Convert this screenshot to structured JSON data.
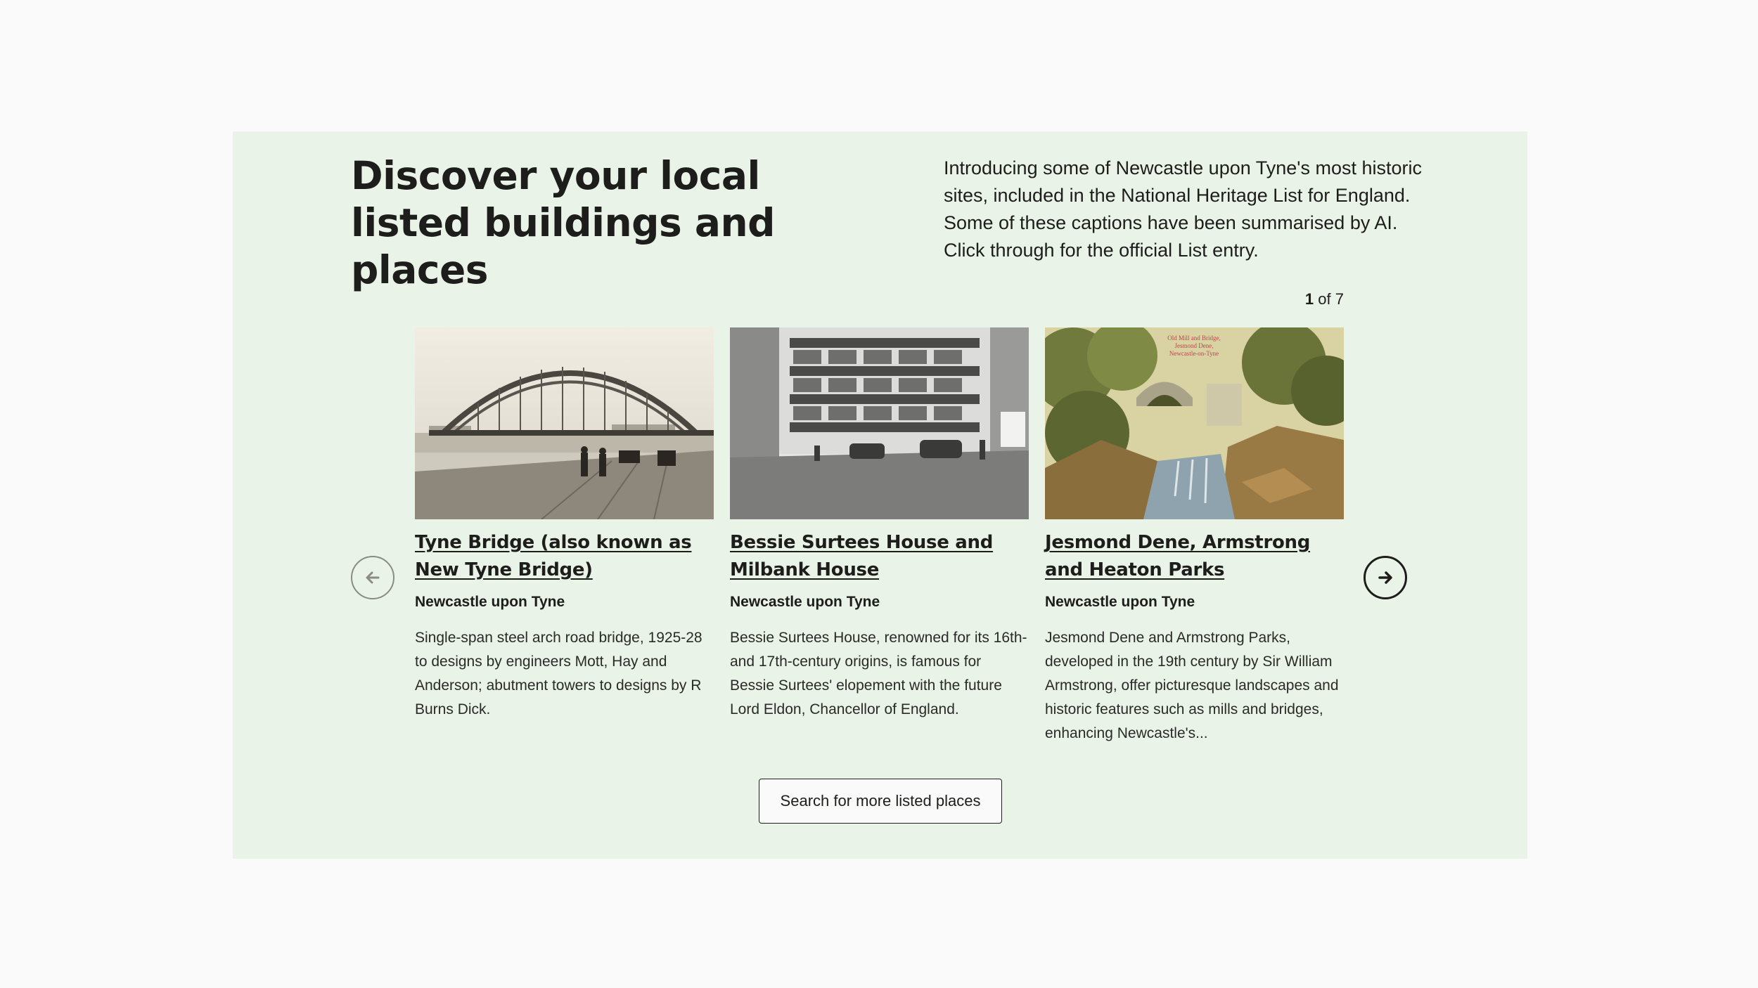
{
  "section": {
    "title": "Discover your local listed buildings and places",
    "intro": "Introducing some of Newcastle upon Tyne's most historic sites, included in the National Heritage List for England. Some of these captions have been summarised by AI. Click through for the official List entry."
  },
  "pager": {
    "current": "1",
    "separator": "of",
    "total": "7"
  },
  "nav": {
    "prev_icon": "arrow-left-icon",
    "next_icon": "arrow-right-icon"
  },
  "cards": [
    {
      "title": "Tyne Bridge (also known as New Tyne Bridge)",
      "location": "Newcastle upon Tyne",
      "description": "Single-span steel arch road bridge, 1925-28 to designs by engineers Mott, Hay and Anderson; abutment towers to designs by R Burns Dick."
    },
    {
      "title": "Bessie Surtees House and Milbank House",
      "location": "Newcastle upon Tyne",
      "description": "Bessie Surtees House, renowned for its 16th- and 17th-century origins, is famous for Bessie Surtees' elopement with the future Lord Eldon, Chancellor of England."
    },
    {
      "title": "Jesmond Dene, Armstrong and Heaton Parks",
      "location": "Newcastle upon Tyne",
      "description": "Jesmond Dene and Armstrong Parks, developed in the 19th century by Sir William Armstrong, offer picturesque landscapes and historic features such as mills and bridges, enhancing Newcastle's..."
    }
  ],
  "search_button": {
    "label": "Search for more listed places"
  },
  "colors": {
    "panel_bg": "#eaf3e8",
    "page_bg": "#fafafa",
    "text": "#1d1d1b"
  }
}
